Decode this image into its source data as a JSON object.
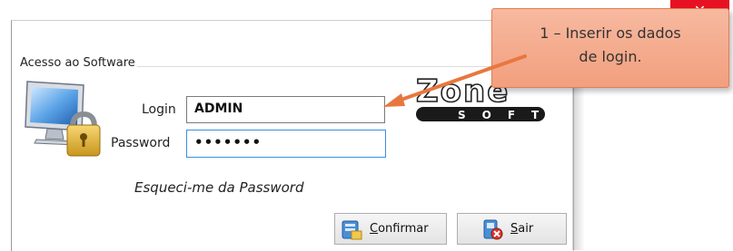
{
  "window": {
    "close_glyph": "✕"
  },
  "group": {
    "title": "Acesso ao Software"
  },
  "form": {
    "login_label": "Login",
    "login_value": "ADMIN",
    "password_label": "Password",
    "password_value": "•••••••",
    "forgot_link": "Esqueci-me da Password"
  },
  "logo": {
    "brand": "Zone",
    "subtext": "SOFT"
  },
  "buttons": {
    "confirm_first": "C",
    "confirm_rest": "onfirmar",
    "exit_first": "S",
    "exit_rest": "air"
  },
  "callout": {
    "text_line1": "1 – Inserir os dados",
    "text_line2": "de login."
  },
  "colors": {
    "callout_fill": "#f29f7d",
    "callout_border": "#e07d57",
    "arrow": "#e8773f",
    "focus_border": "#3a8ee6",
    "close_button": "#e81123"
  },
  "icons": {
    "monitor": "monitor-lock-icon",
    "confirm": "confirm-icon",
    "exit": "exit-icon",
    "close": "close-icon"
  }
}
